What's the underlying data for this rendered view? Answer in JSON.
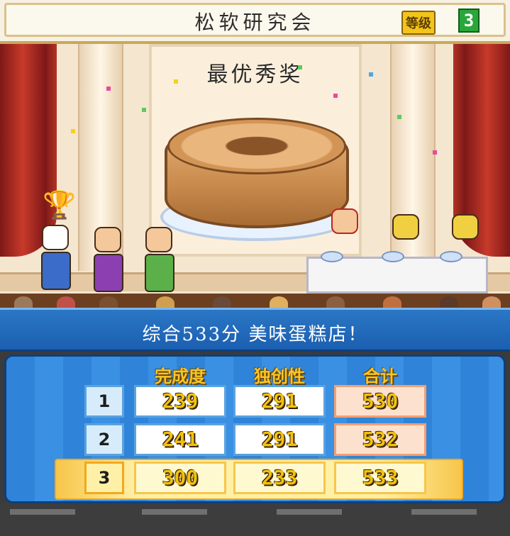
{
  "header": {
    "recipe_name": "松软研究会",
    "level_label": "等级",
    "level_value": "3"
  },
  "stage": {
    "award_title": "最优秀奖",
    "trophy": "trophy-icon",
    "dish": "cake-ring"
  },
  "result": {
    "summary": "综合533分 美味蛋糕店！"
  },
  "scores": {
    "columns": [
      "完成度",
      "独创性",
      "合计"
    ],
    "rows": [
      {
        "label": "1",
        "cells": [
          "239",
          "291",
          "530"
        ]
      },
      {
        "label": "2",
        "cells": [
          "241",
          "291",
          "532"
        ]
      },
      {
        "label": "3",
        "cells": [
          "300",
          "233",
          "533"
        ]
      }
    ],
    "highlighted_row": "3"
  },
  "colors": {
    "banner_blue": "#2b77c6",
    "score_gold": "#f2c20e",
    "highlight": "#fff0a8"
  }
}
